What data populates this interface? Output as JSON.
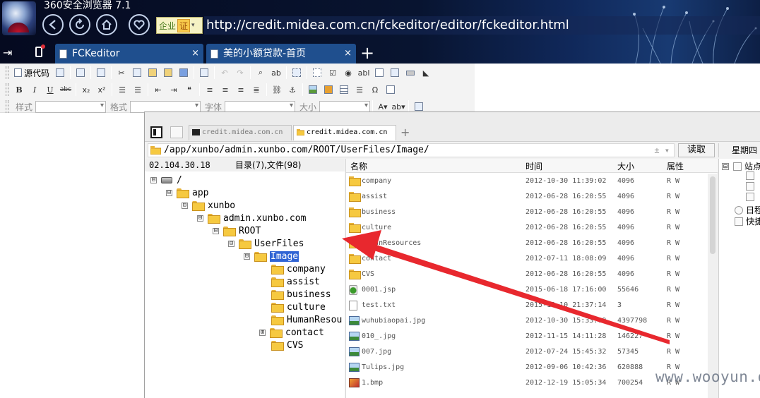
{
  "browser": {
    "title": "360安全浏览器 7.1",
    "address_badge": {
      "label": "企业",
      "cert": "证"
    },
    "url": {
      "host_prefix": "http://credit.",
      "host_mid": "midea.com.cn",
      "path": "/fckeditor/editor/fckeditor.html"
    },
    "nav_icons": [
      "back-icon",
      "refresh-icon",
      "home-icon",
      "favorite-icon"
    ],
    "tabs": [
      {
        "label": "FCKeditor",
        "close": "×"
      },
      {
        "label": "美的小额贷款-首页",
        "close": "×"
      }
    ],
    "new_tab": "+"
  },
  "toolbar": {
    "row1": {
      "source_label": "源代码"
    },
    "row3": {
      "style_label": "样式",
      "format_label": "格式",
      "font_label": "字体",
      "size_label": "大小"
    }
  },
  "file_manager": {
    "tabs": [
      {
        "label": "credit.midea.com.cn"
      },
      {
        "label": "credit.midea.com.cn"
      }
    ],
    "new_tab": "+",
    "path": "/app/xunbo/admin.xunbo.com/ROOT/UserFiles/Image/",
    "path_ctrl": "± ▾",
    "read_button": "读取",
    "weekday": "星期四",
    "status_ip": "02.104.30.18",
    "status_counts": "目录(7),文件(98)",
    "tree": [
      {
        "label": "/",
        "expander": "⊟",
        "icon": "drive"
      },
      {
        "label": "app",
        "expander": "⊟"
      },
      {
        "label": "xunbo",
        "expander": "⊟"
      },
      {
        "label": "admin.xunbo.com",
        "expander": "⊟"
      },
      {
        "label": "ROOT",
        "expander": "⊟"
      },
      {
        "label": "UserFiles",
        "expander": "⊟"
      },
      {
        "label": "Image",
        "expander": "⊟",
        "selected": true
      },
      {
        "label": "company"
      },
      {
        "label": "assist"
      },
      {
        "label": "business"
      },
      {
        "label": "culture"
      },
      {
        "label": "HumanResou"
      },
      {
        "label": "contact",
        "expander": "⊞"
      },
      {
        "label": "CVS"
      }
    ],
    "columns": {
      "name": "名称",
      "time": "时间",
      "size": "大小",
      "attr": "属性"
    },
    "files": [
      {
        "name": "company",
        "time": "2012-10-30 11:39:02",
        "size": "4096",
        "attr": "R W",
        "type": "folder"
      },
      {
        "name": "assist",
        "time": "2012-06-28 16:20:55",
        "size": "4096",
        "attr": "R W",
        "type": "folder"
      },
      {
        "name": "business",
        "time": "2012-06-28 16:20:55",
        "size": "4096",
        "attr": "R W",
        "type": "folder"
      },
      {
        "name": "culture",
        "time": "2012-06-28 16:20:55",
        "size": "4096",
        "attr": "R W",
        "type": "folder"
      },
      {
        "name": "HumanResources",
        "time": "2012-06-28 16:20:55",
        "size": "4096",
        "attr": "R W",
        "type": "folder"
      },
      {
        "name": "contact",
        "time": "2012-07-11 18:08:09",
        "size": "4096",
        "attr": "R W",
        "type": "folder"
      },
      {
        "name": "CVS",
        "time": "2012-06-28 16:20:55",
        "size": "4096",
        "attr": "R W",
        "type": "folder"
      },
      {
        "name": "0001.jsp",
        "time": "2015-06-18 17:16:00",
        "size": "55646",
        "attr": "R W",
        "type": "jsp"
      },
      {
        "name": "test.txt",
        "time": "2015-12-10 21:37:14",
        "size": "3",
        "attr": "R W",
        "type": "txt"
      },
      {
        "name": "wuhubiaopai.jpg",
        "time": "2012-10-30 15:33:09",
        "size": "4397798",
        "attr": "R W",
        "type": "img"
      },
      {
        "name": "010_.jpg",
        "time": "2012-11-15 14:11:28",
        "size": "146227",
        "attr": "R W",
        "type": "img"
      },
      {
        "name": "007.jpg",
        "time": "2012-07-24 15:45:32",
        "size": "57345",
        "attr": "R W",
        "type": "img"
      },
      {
        "name": "Tulips.jpg",
        "time": "2012-09-06 10:42:36",
        "size": "620888",
        "attr": "R W",
        "type": "img"
      },
      {
        "name": "1.bmp",
        "time": "2012-12-19 15:05:34",
        "size": "700254",
        "attr": "R W",
        "type": "bmp"
      }
    ],
    "right_panel": {
      "items": [
        {
          "expander": "⊟",
          "label": "站点"
        },
        {
          "label": "日程"
        },
        {
          "label": "快捷"
        }
      ]
    }
  },
  "watermark": "www.wooyun.org",
  "colors": {
    "selection": "#3064d4",
    "arrow": "#e8282e",
    "browser_tab": "#1f4f8e"
  }
}
